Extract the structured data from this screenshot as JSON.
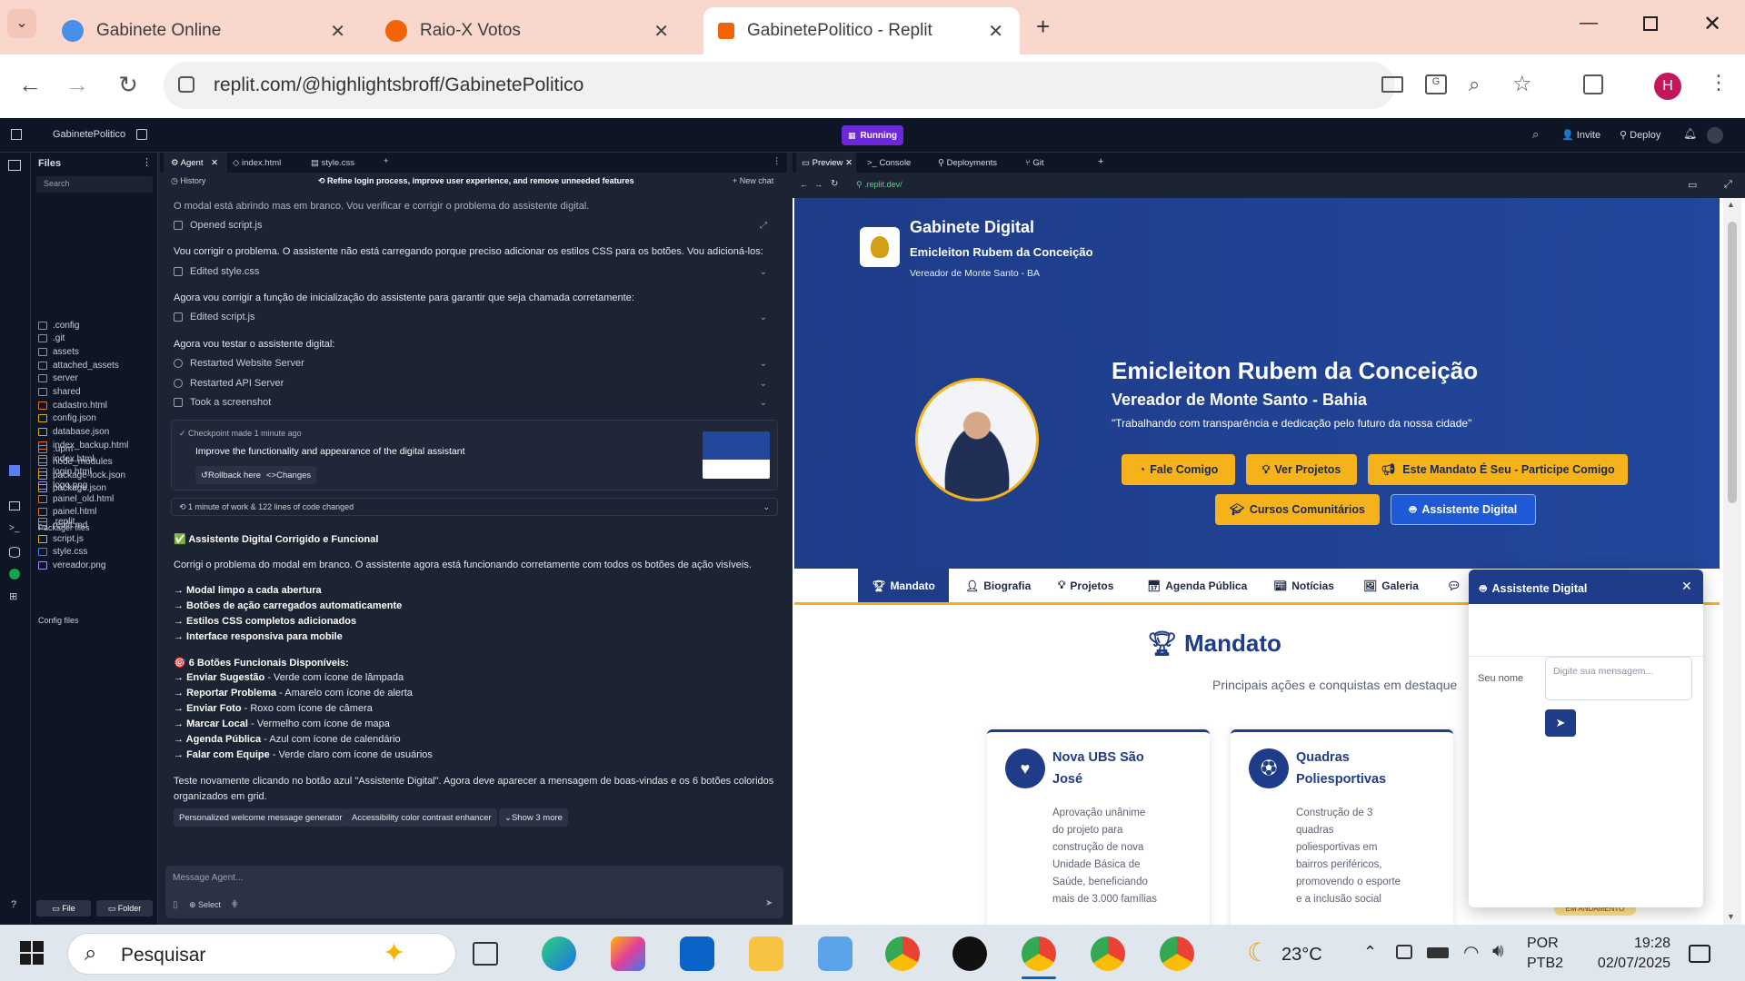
{
  "browser": {
    "tabs": [
      {
        "title": "Gabinete Online"
      },
      {
        "title": "Raio-X Votos"
      },
      {
        "title": "GabinetePolitico - Replit"
      }
    ],
    "url": "replit.com/@highlightsbroff/GabinetePolitico",
    "profile": "H"
  },
  "replit": {
    "project": "GabinetePolitico",
    "status": "Running",
    "invite": "Invite",
    "deploy": "Deploy",
    "files_title": "Files",
    "search": "Search",
    "files": [
      ".config",
      ".git",
      "assets",
      "attached_assets",
      "server",
      "shared",
      "cadastro.html",
      "config.json",
      "database.json",
      "index_backup.html",
      "index.html",
      "login.html",
      "logo.png",
      "painel_old.html",
      "painel.html",
      "replit.md",
      "script.js",
      "style.css",
      "vereador.png"
    ],
    "packager_title": "Packager files",
    "packager": [
      ".upm",
      "node_modules",
      "package-lock.json",
      "package.json"
    ],
    "config_title": "Config files",
    "config": [
      ".replit"
    ],
    "file_btn": "File",
    "folder_btn": "Folder",
    "editor_tabs": [
      "Agent",
      "index.html",
      "style.css"
    ],
    "history": "History",
    "chat_title": "Refine login process, improve user experience, and remove unneeded features",
    "new_chat": "New chat",
    "msgs": {
      "m0": "O modal está abrindo mas em branco. Vou verificar e corrigir o problema do assistente digital.",
      "e0": "Opened script.js",
      "m1": "Vou corrigir o problema. O assistente não está carregando porque preciso adicionar os estilos CSS para os botões. Vou adicioná-los:",
      "e1": "Edited style.css",
      "m2": "Agora vou corrigir a função de inicialização do assistente para garantir que seja chamada corretamente:",
      "e2": "Edited script.js",
      "m3": "Agora vou testar o assistente digital:",
      "e3": "Restarted Website Server",
      "e4": "Restarted API Server",
      "e5": "Took a screenshot"
    },
    "checkpoint": {
      "time": "Checkpoint made 1 minute ago",
      "title": "Improve the functionality and appearance of the digital assistant",
      "rollback": "Rollback here",
      "changes": "Changes"
    },
    "work": "1 minute of work & 122 lines of code changed",
    "summary": {
      "title": "✅ Assistente Digital Corrigido e Funcional",
      "p": "Corrigi o problema do modal em branco. O assistente agora está funcionando corretamente com todos os botões de ação visíveis.",
      "l1": "→ Modal limpo a cada abertura",
      "l2": "→ Botões de ação carregados automaticamente",
      "l3": "→ Estilos CSS completos adicionados",
      "l4": "→ Interface responsiva para mobile",
      "btitle": "🎯 6 Botões Funcionais Disponíveis:",
      "b1k": "Enviar Sugestão",
      "b1v": " - Verde com ícone de lâmpada",
      "b2k": "Reportar Problema",
      "b2v": " - Amarelo com ícone de alerta",
      "b3k": "Enviar Foto",
      "b3v": " - Roxo com ícone de câmera",
      "b4k": "Marcar Local",
      "b4v": " - Vermelho com ícone de mapa",
      "b5k": "Agenda Pública",
      "b5v": " - Azul com ícone de calendário",
      "b6k": "Falar com Equipe",
      "b6v": " - Verde claro com ícone de usuários",
      "final1": "Teste novamente clicando no botão azul \"Assistente Digital\". Agora deve aparecer a mensagem de boas-vindas e os 6 botões coloridos",
      "final2": "organizados em grid."
    },
    "suggest": [
      "Personalized welcome message generator",
      "Accessibility color contrast enhancer",
      "Show 3 more"
    ],
    "input_ph": "Message Agent...",
    "select": "Select",
    "preview_tabs": [
      "Preview",
      "Console",
      "Deployments",
      "Git"
    ],
    "preview_url": ".replit.dev/"
  },
  "site": {
    "brand": "Gabinete Digital",
    "name": "Emicleiton Rubem da Conceição",
    "role": "Vereador de Monte Santo - BA",
    "hero_name": "Emicleiton Rubem da Conceição",
    "hero_role": "Vereador de Monte Santo - Bahia",
    "quote": "\"Trabalhando com transparência e dedicação pelo futuro da nossa cidade\"",
    "btns": [
      "Fale Comigo",
      "Ver Projetos",
      "Este Mandato É Seu - Participe Comigo",
      "Cursos Comunitários",
      "Assistente Digital"
    ],
    "nav": [
      "Mandato",
      "Biografia",
      "Projetos",
      "Agenda Pública",
      "Notícias",
      "Galeria"
    ],
    "section_title": "Mandato",
    "section_sub": "Principais ações e conquistas em destaque",
    "card1": {
      "title1": "Nova UBS São",
      "title2": "José",
      "text": [
        "Aprovação unânime",
        "do projeto para",
        "construção de nova",
        "Unidade Básica de",
        "Saúde, beneficiando",
        "mais de 3.000 famílias"
      ]
    },
    "card2": {
      "title1": "Quadras",
      "title2": "Poliesportivas",
      "text": [
        "Construção de 3",
        "quadras",
        "poliesportivas em",
        "bairros periféricos,",
        "promovendo o esporte",
        "e a inclusão social"
      ]
    },
    "badge": "EM ANDAMENTO",
    "chat": {
      "title": "Assistente Digital",
      "name_ph": "Seu nome",
      "msg_ph": "Digite sua mensagem..."
    }
  },
  "taskbar": {
    "search": "Pesquisar",
    "temp": "23°C",
    "lang1": "POR",
    "lang2": "PTB2",
    "time": "19:28",
    "date": "02/07/2025"
  }
}
